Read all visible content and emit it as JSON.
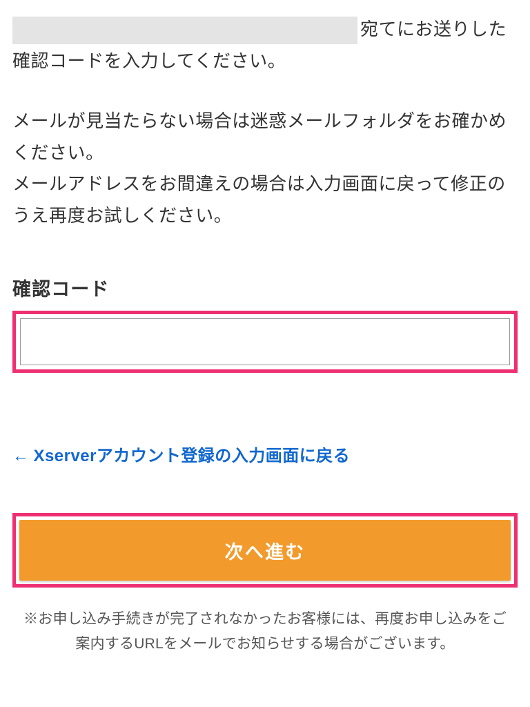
{
  "instruction": {
    "suffix": "宛てにお送りした確認コードを入力してください。"
  },
  "subInstruction": {
    "line1": "メールが見当たらない場合は迷惑メールフォルダをお確かめください。",
    "line2": "メールアドレスをお間違えの場合は入力画面に戻って修正のうえ再度お試しください。"
  },
  "form": {
    "codeLabel": "確認コード",
    "codeValue": ""
  },
  "backLink": {
    "text": "Xserverアカウント登録の入力画面に戻る"
  },
  "submitButton": {
    "label": "次へ進む"
  },
  "footerNote": "※お申し込み手続きが完了されなかったお客様には、再度お申し込みをご案内するURLをメールでお知らせする場合がございます。"
}
